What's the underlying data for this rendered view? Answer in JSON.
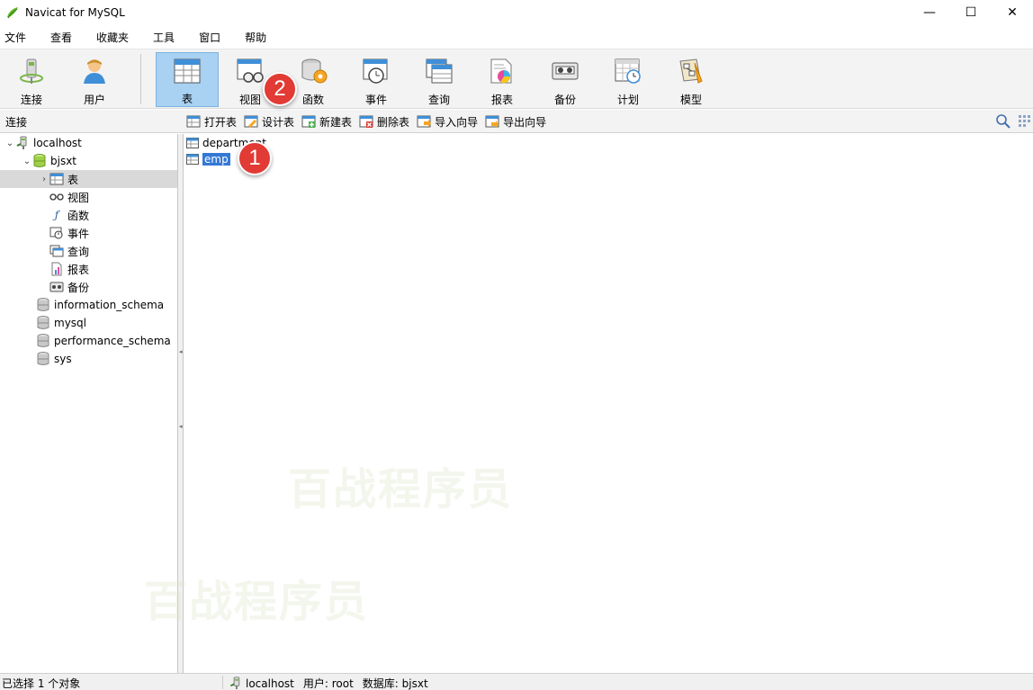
{
  "window": {
    "title": "Navicat for MySQL",
    "controls": [
      "—",
      "☐",
      "✕"
    ]
  },
  "menu": [
    "文件",
    "查看",
    "收藏夹",
    "工具",
    "窗口",
    "帮助"
  ],
  "toolbar": {
    "buttons": [
      {
        "label": "连接",
        "icon": "connection-icon"
      },
      {
        "label": "用户",
        "icon": "user-icon"
      },
      {
        "label": "表",
        "icon": "table-icon",
        "active": true
      },
      {
        "label": "视图",
        "icon": "view-icon"
      },
      {
        "label": "函数",
        "icon": "function-icon"
      },
      {
        "label": "事件",
        "icon": "event-icon"
      },
      {
        "label": "查询",
        "icon": "query-icon"
      },
      {
        "label": "报表",
        "icon": "report-icon"
      },
      {
        "label": "备份",
        "icon": "backup-icon"
      },
      {
        "label": "计划",
        "icon": "schedule-icon"
      },
      {
        "label": "模型",
        "icon": "model-icon"
      }
    ]
  },
  "markers": {
    "first": "1",
    "second": "2"
  },
  "subbar": {
    "connection_label": "连接",
    "actions": [
      "打开表",
      "设计表",
      "新建表",
      "删除表",
      "导入向导",
      "导出向导"
    ]
  },
  "tree": {
    "localhost": "localhost",
    "bjsxt": "bjsxt",
    "children": [
      "表",
      "视图",
      "函数",
      "事件",
      "查询",
      "报表",
      "备份"
    ],
    "databases": [
      "information_schema",
      "mysql",
      "performance_schema",
      "sys"
    ]
  },
  "objects": [
    "department",
    "emp"
  ],
  "watermark": "百战程序员",
  "status": {
    "selection": "已选择 1 个对象",
    "host": "localhost",
    "user": "用户: root",
    "database": "数据库: bjsxt"
  },
  "colors": {
    "active_button": "#a8d1f2",
    "selection": "#3478d6",
    "marker": "#e23a34"
  }
}
